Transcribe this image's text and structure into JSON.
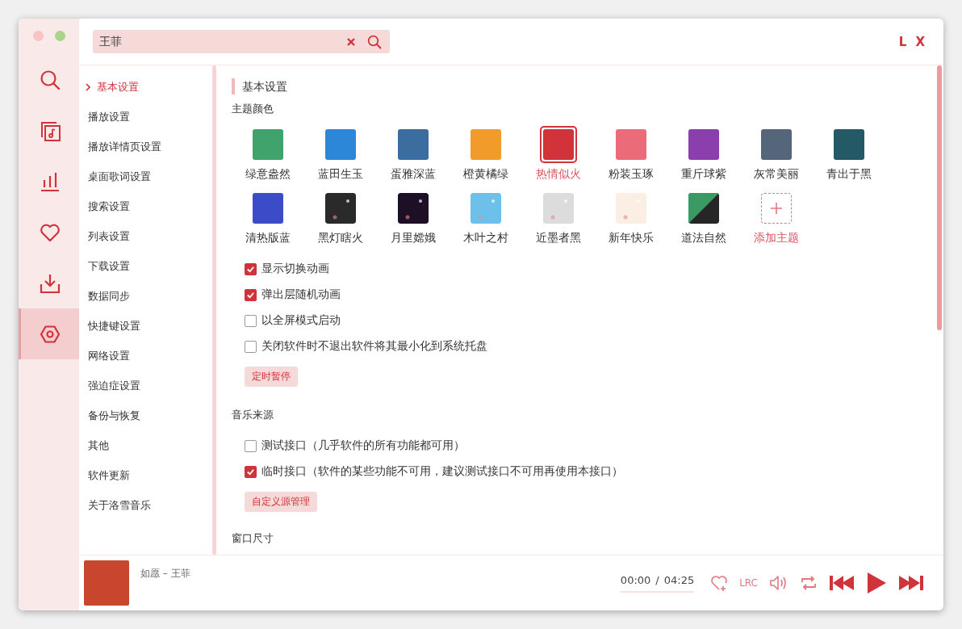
{
  "search": {
    "value": "王菲"
  },
  "logo": "L X",
  "nav": [
    {
      "kind": "search",
      "selected": false
    },
    {
      "kind": "music",
      "selected": false
    },
    {
      "kind": "chart",
      "selected": false
    },
    {
      "kind": "heart",
      "selected": false
    },
    {
      "kind": "download",
      "selected": false
    },
    {
      "kind": "settings",
      "selected": true
    }
  ],
  "settings_menu": [
    {
      "label": "基本设置",
      "selected": true
    },
    {
      "label": "播放设置",
      "selected": false
    },
    {
      "label": "播放详情页设置",
      "selected": false
    },
    {
      "label": "桌面歌词设置",
      "selected": false
    },
    {
      "label": "搜索设置",
      "selected": false
    },
    {
      "label": "列表设置",
      "selected": false
    },
    {
      "label": "下载设置",
      "selected": false
    },
    {
      "label": "数据同步",
      "selected": false
    },
    {
      "label": "快捷键设置",
      "selected": false
    },
    {
      "label": "网络设置",
      "selected": false
    },
    {
      "label": "强迫症设置",
      "selected": false
    },
    {
      "label": "备份与恢复",
      "selected": false
    },
    {
      "label": "其他",
      "selected": false
    },
    {
      "label": "软件更新",
      "selected": false
    },
    {
      "label": "关于洛雪音乐",
      "selected": false
    }
  ],
  "section_title": "基本设置",
  "theme": {
    "label": "主题颜色",
    "items": [
      {
        "kind": "color",
        "name": "绿意盎然",
        "color": "#3fa36b",
        "selected": false
      },
      {
        "kind": "color",
        "name": "蓝田生玉",
        "color": "#2d86d8",
        "selected": false
      },
      {
        "kind": "color",
        "name": "蛋雅深蓝",
        "color": "#3b6d9e",
        "selected": false
      },
      {
        "kind": "color",
        "name": "橙黄橘绿",
        "color": "#f09b2a",
        "selected": false
      },
      {
        "kind": "color",
        "name": "热情似火",
        "color": "#d0333a",
        "selected": true
      },
      {
        "kind": "color",
        "name": "粉装玉琢",
        "color": "#eb6b7a",
        "selected": false
      },
      {
        "kind": "color",
        "name": "重斤球紫",
        "color": "#8a3fad",
        "selected": false
      },
      {
        "kind": "color",
        "name": "灰常美丽",
        "color": "#56667a",
        "selected": false
      },
      {
        "kind": "color",
        "name": "青出于黑",
        "color": "#245a66",
        "selected": false
      },
      {
        "kind": "color",
        "name": "清热版蓝",
        "color": "#3c4bc8",
        "selected": false
      },
      {
        "kind": "image",
        "name": "黑灯瞎火",
        "color": "#2a2a2a",
        "selected": false
      },
      {
        "kind": "image",
        "name": "月里嫦娥",
        "color": "#1c0f26",
        "selected": false
      },
      {
        "kind": "image",
        "name": "木叶之村",
        "color": "#6cc0ea",
        "selected": false
      },
      {
        "kind": "image",
        "name": "近墨者黑",
        "color": "#dcdcdc",
        "selected": false
      },
      {
        "kind": "image",
        "name": "新年快乐",
        "color": "#fbeee2",
        "selected": false
      },
      {
        "kind": "split",
        "name": "道法自然",
        "color": "#3a9a63",
        "selected": false
      }
    ],
    "add_label": "添加主题"
  },
  "options": [
    {
      "label": "显示切换动画",
      "checked": true
    },
    {
      "label": "弹出层随机动画",
      "checked": true
    },
    {
      "label": "以全屏模式启动",
      "checked": false
    },
    {
      "label": "关闭软件时不退出软件将其最小化到系统托盘",
      "checked": false
    }
  ],
  "timer_button": "定时暂停",
  "music_source": {
    "label": "音乐来源",
    "options": [
      {
        "label": "测试接口（几乎软件的所有功能都可用）",
        "checked": false
      },
      {
        "label": "临时接口（软件的某些功能不可用，建议测试接口不可用再使用本接口）",
        "checked": true
      }
    ],
    "button": "自定义源管理"
  },
  "next_section": "窗口尺寸",
  "player": {
    "title": "如愿 – 王菲",
    "time": "00:00",
    "separator": "/",
    "duration": "04:25",
    "lyrics_button": "LRC"
  }
}
